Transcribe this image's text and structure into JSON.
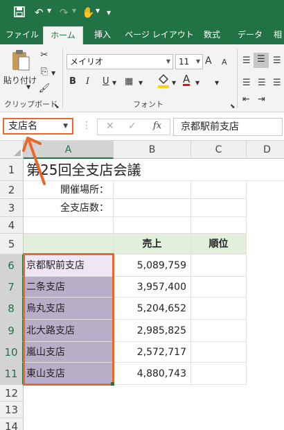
{
  "ribbon_tabs": [
    "ファイル",
    "ホーム",
    "挿入",
    "ページ レイアウト",
    "数式",
    "データ",
    "相"
  ],
  "active_tab": "ホーム",
  "ribbon": {
    "paste_label": "貼り付け",
    "clipboard_group": "クリップボード",
    "font_group": "フォント",
    "font_name": "メイリオ",
    "font_size": "11",
    "bold": "B",
    "italic": "I",
    "underline": "U",
    "font_color_glyph": "A",
    "grow_glyph": "A",
    "shrink_glyph": "A"
  },
  "formula_bar": {
    "name_box": "支店名",
    "fx": "fx",
    "content": "京都駅前支店"
  },
  "columns": [
    "A",
    "B",
    "C",
    "D"
  ],
  "rows": [
    "1",
    "2",
    "3",
    "4",
    "5",
    "6",
    "7",
    "8",
    "9",
    "10",
    "11",
    "12",
    "13",
    "14"
  ],
  "sheet": {
    "title": "第25回全支店会議",
    "venue_label": "開催場所：",
    "branch_count_label": "全支店数：",
    "header_sales": "売上",
    "header_rank": "順位",
    "branches": [
      {
        "name": "京都駅前支店",
        "sales": "5,089,759"
      },
      {
        "name": "二条支店",
        "sales": "3,957,400"
      },
      {
        "name": "烏丸支店",
        "sales": "5,204,652"
      },
      {
        "name": "北大路支店",
        "sales": "2,985,825"
      },
      {
        "name": "嵐山支店",
        "sales": "2,572,717"
      },
      {
        "name": "東山支店",
        "sales": "4,880,743"
      }
    ]
  },
  "colors": {
    "excel_green": "#217346",
    "highlight_orange": "#e8672a",
    "selection_fill": "#b9aec7",
    "header_fill": "#e2efda"
  }
}
